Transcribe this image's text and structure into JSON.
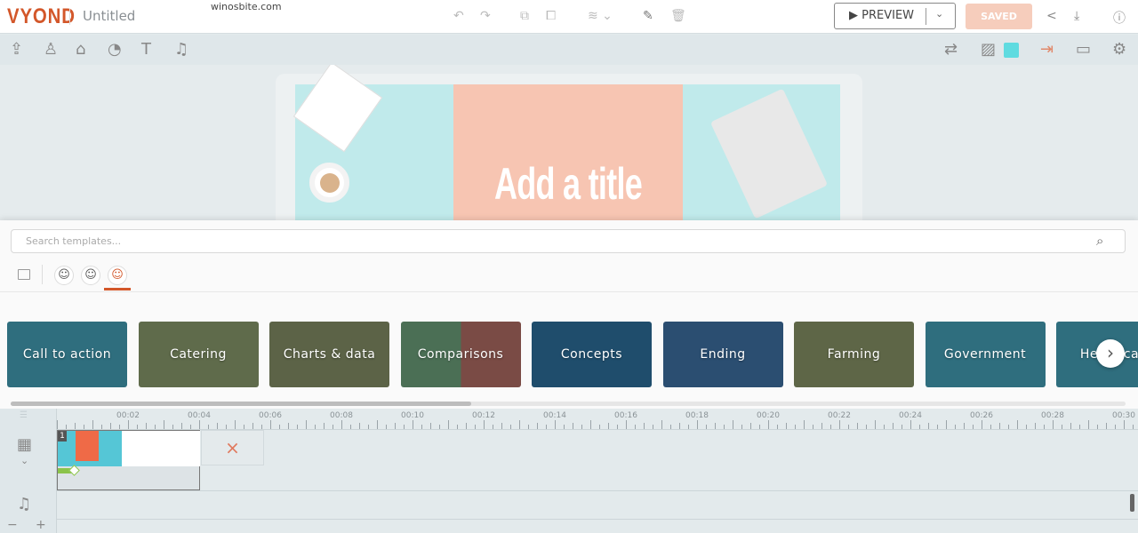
{
  "app": {
    "logo": "VYOND",
    "title": "Untitled",
    "watermark": "winosbite.com"
  },
  "topbar": {
    "preview_label": "▶ PREVIEW",
    "saved_label": "SAVED",
    "icons": [
      "undo-icon",
      "redo-icon",
      "copy-icon",
      "paste-icon",
      "layers-icon",
      "brush-icon",
      "trash-icon",
      "share-icon",
      "download-icon",
      "help-icon"
    ]
  },
  "toolbar": {
    "left_icons": [
      "upload-icon",
      "character-icon",
      "props-icon",
      "chart-icon",
      "text-icon",
      "music-icon"
    ],
    "right_icons": [
      "swap-icon",
      "background-image-icon",
      "background-color-swatch",
      "enter-icon",
      "camera-icon",
      "settings-icon"
    ],
    "swatch_color": "#5fdbe0"
  },
  "scene": {
    "title": "Add a title"
  },
  "templates": {
    "search_placeholder": "Search templates...",
    "categories": [
      {
        "label": "Call to action",
        "color": "#2f6e7e"
      },
      {
        "label": "Catering",
        "color": "#5f6b4b"
      },
      {
        "label": "Charts & data",
        "color": "#5c6347"
      },
      {
        "label": "Comparisons",
        "color": "#4b6f55"
      },
      {
        "label": "Concepts",
        "color": "#1f4d6c"
      },
      {
        "label": "Ending",
        "color": "#2b4e71"
      },
      {
        "label": "Farming",
        "color": "#5e6647"
      },
      {
        "label": "Government",
        "color": "#2f6e7e"
      },
      {
        "label": "Healthcare",
        "color": "#2f6e7e"
      }
    ]
  },
  "timeline": {
    "ticks": [
      "00:02",
      "00:04",
      "00:06",
      "00:08",
      "00:10",
      "00:12",
      "00:14",
      "00:16",
      "00:18",
      "00:20",
      "00:22",
      "00:24",
      "00:26",
      "00:28",
      "00:30"
    ],
    "scene_number": "1",
    "add_scene_icon": "×",
    "zoom_out": "−",
    "zoom_in": "+"
  },
  "colors": {
    "accent": "#d3572a",
    "saved": "#f6cdbc"
  }
}
